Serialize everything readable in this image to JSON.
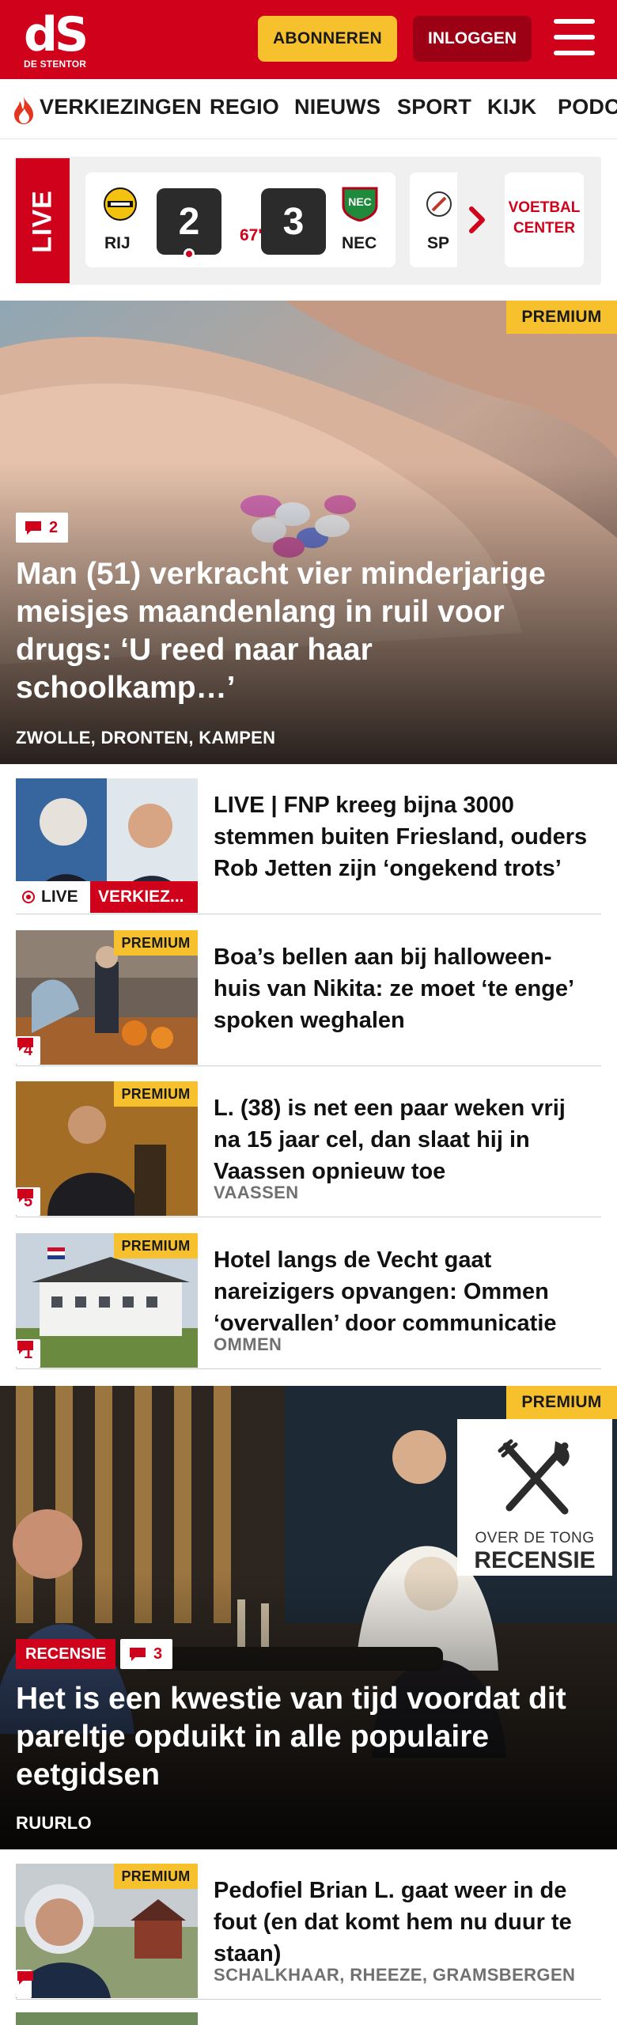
{
  "header": {
    "logo_mark": "dS",
    "logo_text": "DE STENTOR",
    "subscribe_label": "ABONNEREN",
    "login_label": "INLOGGEN",
    "brand_color": "#d0021b",
    "accent_color": "#f6c12c"
  },
  "nav": {
    "items": [
      {
        "label": "VERKIEZINGEN",
        "icon": "flame-icon"
      },
      {
        "label": "REGIO"
      },
      {
        "label": "NIEUWS"
      },
      {
        "label": "SPORT"
      },
      {
        "label": "KIJK"
      },
      {
        "label": "PODCAST"
      }
    ]
  },
  "live_bar": {
    "live_label": "LIVE",
    "match": {
      "home_abbr": "RIJ",
      "home_score": "2",
      "minute": "67'",
      "away_score": "3",
      "away_abbr": "NEC"
    },
    "next_match_abbr": "SP",
    "voetbal_center_line1": "VOETBAL",
    "voetbal_center_line2": "CENTER"
  },
  "hero": {
    "premium_label": "PREMIUM",
    "comment_count": "2",
    "title": "Man (51) verkracht vier minderjarige meisjes maandenlang in ruil voor drugs: ‘U reed naar haar schoolkamp…’",
    "location": "ZWOLLE, DRONTEN, KAMPEN"
  },
  "articles": [
    {
      "title": "LIVE | FNP kreeg bijna 3000 stemmen buiten Friesland, ouders Rob Jetten zijn ‘ongekend trots’",
      "live_label": "LIVE",
      "category_label": "VERKIEZ..."
    },
    {
      "title": "Boa’s bellen aan bij halloween-huis van Nikita: ze moet ‘te enge’ spoken weghalen",
      "premium_label": "PREMIUM",
      "comment_count": "4"
    },
    {
      "title": "L. (38) is net een paar weken vrij na 15 jaar cel, dan slaat hij in Vaassen opnieuw toe",
      "premium_label": "PREMIUM",
      "comment_count": "5",
      "location": "VAASSEN"
    },
    {
      "title": "Hotel langs de Vecht gaat nareizigers opvangen: Ommen ‘overvallen’ door communicatie",
      "premium_label": "PREMIUM",
      "comment_count": "1",
      "location": "OMMEN"
    }
  ],
  "hero2": {
    "premium_label": "PREMIUM",
    "odt_line1": "OVER DE TONG",
    "odt_line2": "RECENSIE",
    "recensie_label": "RECENSIE",
    "comment_count": "3",
    "title": "Het is een kwestie van tijd voordat dit pareltje opduikt in alle populaire eetgidsen",
    "location": "RUURLO"
  },
  "articles2": [
    {
      "title": "Pedofiel Brian L. gaat weer in de fout (en dat komt hem nu duur te staan)",
      "premium_label": "PREMIUM",
      "location": "SCHALKHAAR, RHEEZE, GRAMSBERGEN"
    }
  ]
}
